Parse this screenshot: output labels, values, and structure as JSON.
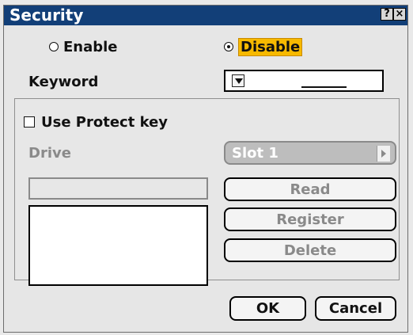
{
  "window": {
    "title": "Security",
    "help_label": "?",
    "close_label": "×"
  },
  "mode": {
    "enable_label": "Enable",
    "disable_label": "Disable",
    "selected": "Disable"
  },
  "keyword": {
    "label": "Keyword",
    "value": ""
  },
  "protect_key": {
    "label": "Use Protect key",
    "checked": false
  },
  "drive": {
    "label": "Drive",
    "value": "Slot 1"
  },
  "buttons": {
    "read": "Read",
    "register": "Register",
    "delete": "Delete",
    "ok": "OK",
    "cancel": "Cancel"
  }
}
